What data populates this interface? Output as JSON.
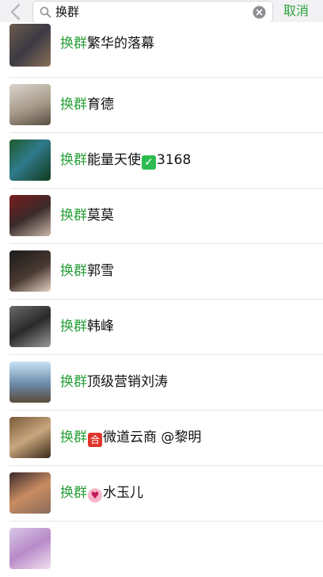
{
  "search": {
    "query": "换群",
    "cancel_label": "取消"
  },
  "results": [
    {
      "highlight": "换群",
      "rest": "繁华的落幕",
      "emoji": "",
      "after": ""
    },
    {
      "highlight": "换群",
      "rest": "育德",
      "emoji": "",
      "after": ""
    },
    {
      "highlight": "换群",
      "rest": "能量天使",
      "emoji": "✓",
      "after": "3168"
    },
    {
      "highlight": "换群",
      "rest": "莫莫",
      "emoji": "",
      "after": ""
    },
    {
      "highlight": "换群",
      "rest": "郭雪",
      "emoji": "",
      "after": ""
    },
    {
      "highlight": "换群",
      "rest": "韩峰",
      "emoji": "",
      "after": ""
    },
    {
      "highlight": "换群",
      "rest": "顶级营销刘涛",
      "emoji": "",
      "after": ""
    },
    {
      "highlight": "换群",
      "rest": "",
      "emoji": "合",
      "after": "微道云商 @黎明"
    },
    {
      "highlight": "换群",
      "rest": "",
      "emoji": "♥",
      "after": "水玉儿"
    }
  ],
  "colors": {
    "accent": "#2aa13a"
  }
}
